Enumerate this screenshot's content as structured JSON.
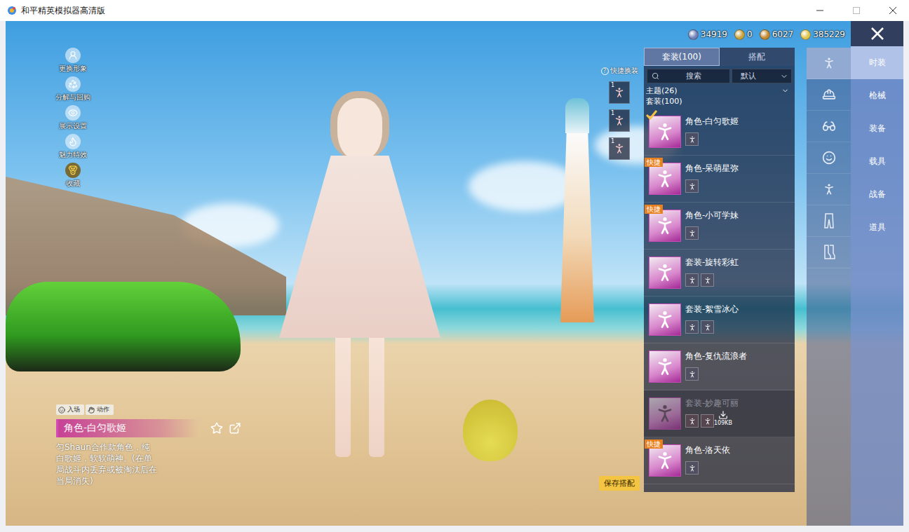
{
  "window": {
    "title": "和平精英模拟器高清版"
  },
  "currencies": [
    {
      "value": "34919"
    },
    {
      "value": "0"
    },
    {
      "value": "6027"
    },
    {
      "value": "385229"
    }
  ],
  "side_menu": [
    {
      "label": "更换形象"
    },
    {
      "label": "分解与回购"
    },
    {
      "label": "展示设置"
    },
    {
      "label": "魅力特效"
    },
    {
      "label": "收藏"
    }
  ],
  "quick_change": {
    "label": "快捷换装",
    "help": "?",
    "slots": [
      {
        "badge": "1"
      },
      {
        "badge": "1"
      },
      {
        "badge": "1"
      }
    ]
  },
  "character": {
    "tags": [
      {
        "label": "入场"
      },
      {
        "label": "动作"
      }
    ],
    "name": "角色-白匀歌姬",
    "description": "匀Shaun合作款角色，纯白歌姬，软软萌神。(在单局战斗内丢弃或被淘汰后在当局消失)",
    "favorited": false
  },
  "save_button": {
    "label": "保存搭配"
  },
  "panel": {
    "tabs": [
      {
        "label": "套装(100)",
        "selected": true
      },
      {
        "label": "搭配",
        "selected": false
      }
    ],
    "search": {
      "placeholder": "搜索"
    },
    "sort": {
      "value": "默认"
    },
    "theme": {
      "label": "主题(26)",
      "expanded": false
    },
    "section": {
      "label": "套装(100)"
    },
    "items": [
      {
        "name": "角色-白匀歌姬",
        "badge": "",
        "selected": true,
        "parts": 1,
        "kind": "normal",
        "size": ""
      },
      {
        "name": "角色-呆萌星弥",
        "badge": "快捷",
        "selected": false,
        "parts": 1,
        "kind": "normal",
        "size": ""
      },
      {
        "name": "角色-小可学妹",
        "badge": "快捷",
        "selected": false,
        "parts": 1,
        "kind": "normal",
        "size": ""
      },
      {
        "name": "套装-旋转彩虹",
        "badge": "",
        "selected": false,
        "parts": 2,
        "kind": "normal",
        "size": ""
      },
      {
        "name": "套装-絮雪冰心",
        "badge": "",
        "selected": false,
        "parts": 2,
        "kind": "normal",
        "size": ""
      },
      {
        "name": "角色-复仇流浪者",
        "badge": "",
        "selected": false,
        "parts": 1,
        "kind": "normal",
        "size": ""
      },
      {
        "name": "套装-妙趣可丽",
        "badge": "",
        "selected": false,
        "parts": 2,
        "kind": "downloading",
        "size": "109KB"
      },
      {
        "name": "角色-洛天依",
        "badge": "快捷",
        "selected": false,
        "parts": 1,
        "kind": "normal",
        "size": ""
      }
    ]
  },
  "categories": [
    {
      "selected": true
    },
    {
      "selected": false
    },
    {
      "selected": false
    },
    {
      "selected": false
    },
    {
      "selected": false
    },
    {
      "selected": false
    },
    {
      "selected": false
    }
  ],
  "nav": [
    {
      "label": "时装",
      "selected": true
    },
    {
      "label": "枪械",
      "selected": false
    },
    {
      "label": "装备",
      "selected": false
    },
    {
      "label": "载具",
      "selected": false
    },
    {
      "label": "战备",
      "selected": false
    },
    {
      "label": "道具",
      "selected": false
    }
  ]
}
